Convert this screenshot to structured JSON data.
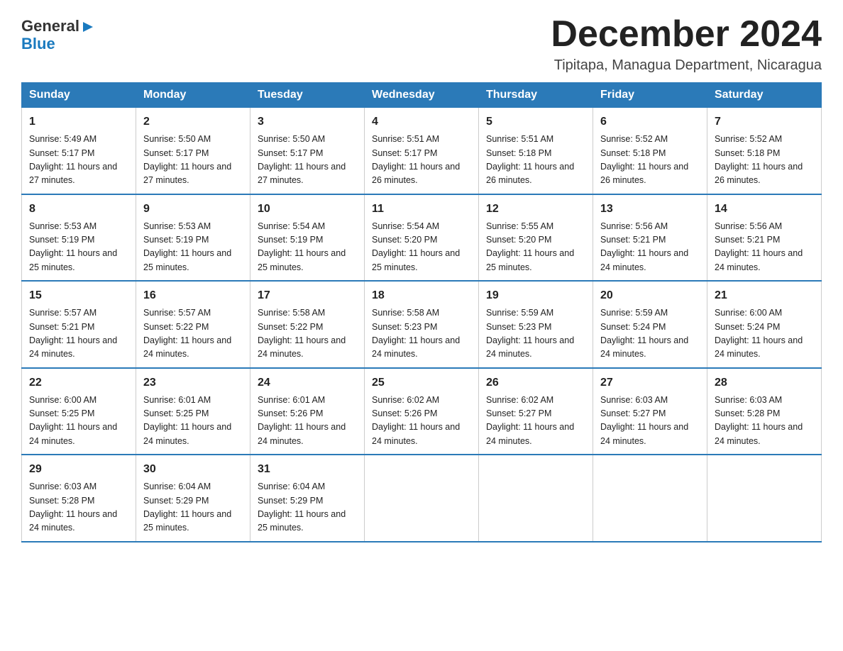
{
  "logo": {
    "general": "General",
    "blue": "Blue",
    "arrow": "▶"
  },
  "header": {
    "month": "December 2024",
    "location": "Tipitapa, Managua Department, Nicaragua"
  },
  "weekdays": [
    "Sunday",
    "Monday",
    "Tuesday",
    "Wednesday",
    "Thursday",
    "Friday",
    "Saturday"
  ],
  "weeks": [
    [
      {
        "day": "1",
        "sunrise": "5:49 AM",
        "sunset": "5:17 PM",
        "daylight": "11 hours and 27 minutes."
      },
      {
        "day": "2",
        "sunrise": "5:50 AM",
        "sunset": "5:17 PM",
        "daylight": "11 hours and 27 minutes."
      },
      {
        "day": "3",
        "sunrise": "5:50 AM",
        "sunset": "5:17 PM",
        "daylight": "11 hours and 27 minutes."
      },
      {
        "day": "4",
        "sunrise": "5:51 AM",
        "sunset": "5:17 PM",
        "daylight": "11 hours and 26 minutes."
      },
      {
        "day": "5",
        "sunrise": "5:51 AM",
        "sunset": "5:18 PM",
        "daylight": "11 hours and 26 minutes."
      },
      {
        "day": "6",
        "sunrise": "5:52 AM",
        "sunset": "5:18 PM",
        "daylight": "11 hours and 26 minutes."
      },
      {
        "day": "7",
        "sunrise": "5:52 AM",
        "sunset": "5:18 PM",
        "daylight": "11 hours and 26 minutes."
      }
    ],
    [
      {
        "day": "8",
        "sunrise": "5:53 AM",
        "sunset": "5:19 PM",
        "daylight": "11 hours and 25 minutes."
      },
      {
        "day": "9",
        "sunrise": "5:53 AM",
        "sunset": "5:19 PM",
        "daylight": "11 hours and 25 minutes."
      },
      {
        "day": "10",
        "sunrise": "5:54 AM",
        "sunset": "5:19 PM",
        "daylight": "11 hours and 25 minutes."
      },
      {
        "day": "11",
        "sunrise": "5:54 AM",
        "sunset": "5:20 PM",
        "daylight": "11 hours and 25 minutes."
      },
      {
        "day": "12",
        "sunrise": "5:55 AM",
        "sunset": "5:20 PM",
        "daylight": "11 hours and 25 minutes."
      },
      {
        "day": "13",
        "sunrise": "5:56 AM",
        "sunset": "5:21 PM",
        "daylight": "11 hours and 24 minutes."
      },
      {
        "day": "14",
        "sunrise": "5:56 AM",
        "sunset": "5:21 PM",
        "daylight": "11 hours and 24 minutes."
      }
    ],
    [
      {
        "day": "15",
        "sunrise": "5:57 AM",
        "sunset": "5:21 PM",
        "daylight": "11 hours and 24 minutes."
      },
      {
        "day": "16",
        "sunrise": "5:57 AM",
        "sunset": "5:22 PM",
        "daylight": "11 hours and 24 minutes."
      },
      {
        "day": "17",
        "sunrise": "5:58 AM",
        "sunset": "5:22 PM",
        "daylight": "11 hours and 24 minutes."
      },
      {
        "day": "18",
        "sunrise": "5:58 AM",
        "sunset": "5:23 PM",
        "daylight": "11 hours and 24 minutes."
      },
      {
        "day": "19",
        "sunrise": "5:59 AM",
        "sunset": "5:23 PM",
        "daylight": "11 hours and 24 minutes."
      },
      {
        "day": "20",
        "sunrise": "5:59 AM",
        "sunset": "5:24 PM",
        "daylight": "11 hours and 24 minutes."
      },
      {
        "day": "21",
        "sunrise": "6:00 AM",
        "sunset": "5:24 PM",
        "daylight": "11 hours and 24 minutes."
      }
    ],
    [
      {
        "day": "22",
        "sunrise": "6:00 AM",
        "sunset": "5:25 PM",
        "daylight": "11 hours and 24 minutes."
      },
      {
        "day": "23",
        "sunrise": "6:01 AM",
        "sunset": "5:25 PM",
        "daylight": "11 hours and 24 minutes."
      },
      {
        "day": "24",
        "sunrise": "6:01 AM",
        "sunset": "5:26 PM",
        "daylight": "11 hours and 24 minutes."
      },
      {
        "day": "25",
        "sunrise": "6:02 AM",
        "sunset": "5:26 PM",
        "daylight": "11 hours and 24 minutes."
      },
      {
        "day": "26",
        "sunrise": "6:02 AM",
        "sunset": "5:27 PM",
        "daylight": "11 hours and 24 minutes."
      },
      {
        "day": "27",
        "sunrise": "6:03 AM",
        "sunset": "5:27 PM",
        "daylight": "11 hours and 24 minutes."
      },
      {
        "day": "28",
        "sunrise": "6:03 AM",
        "sunset": "5:28 PM",
        "daylight": "11 hours and 24 minutes."
      }
    ],
    [
      {
        "day": "29",
        "sunrise": "6:03 AM",
        "sunset": "5:28 PM",
        "daylight": "11 hours and 24 minutes."
      },
      {
        "day": "30",
        "sunrise": "6:04 AM",
        "sunset": "5:29 PM",
        "daylight": "11 hours and 25 minutes."
      },
      {
        "day": "31",
        "sunrise": "6:04 AM",
        "sunset": "5:29 PM",
        "daylight": "11 hours and 25 minutes."
      },
      null,
      null,
      null,
      null
    ]
  ]
}
